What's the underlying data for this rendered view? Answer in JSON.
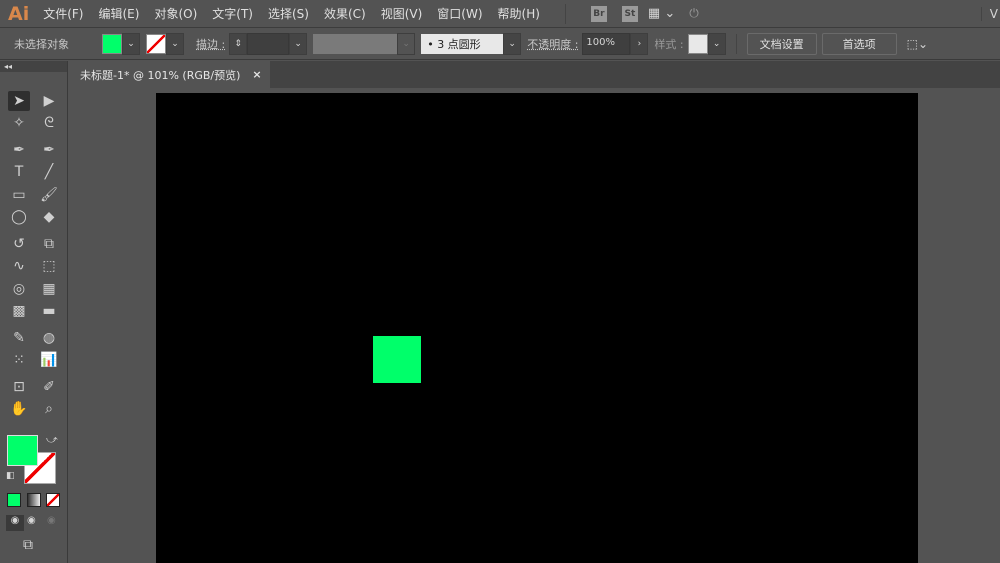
{
  "app": {
    "logo": "Ai"
  },
  "menubar": {
    "items": [
      "文件(F)",
      "编辑(E)",
      "对象(O)",
      "文字(T)",
      "选择(S)",
      "效果(C)",
      "视图(V)",
      "窗口(W)",
      "帮助(H)"
    ],
    "bridge": "Br",
    "stock": "St",
    "right_text": "V"
  },
  "control": {
    "selection": "未选择对象",
    "stroke_label": "描边 :",
    "brush": "•  3 点圆形",
    "opacity_label": "不透明度 :",
    "opacity": "100%",
    "style_label": "样式 :",
    "doc_setup": "文档设置",
    "prefs": "首选项"
  },
  "tab": {
    "title": "未标题-1* @ 101% (RGB/预览)",
    "close": "×"
  },
  "colors": {
    "fill": "#00ff6a",
    "artboard": "#000000",
    "stroke": "none"
  },
  "artwork": {
    "shape": "rectangle",
    "fill": "#00ff6a"
  },
  "tools": [
    "selection",
    "direct-selection",
    "magic-wand",
    "lasso",
    "pen",
    "curvature",
    "type",
    "line",
    "rectangle",
    "paintbrush",
    "shaper",
    "eraser",
    "rotate",
    "scale",
    "warp",
    "free-transform",
    "shape-builder",
    "perspective-grid",
    "mesh",
    "gradient",
    "eyedropper",
    "blend",
    "symbol-sprayer",
    "column-graph",
    "artboard",
    "slice",
    "hand",
    "zoom"
  ]
}
